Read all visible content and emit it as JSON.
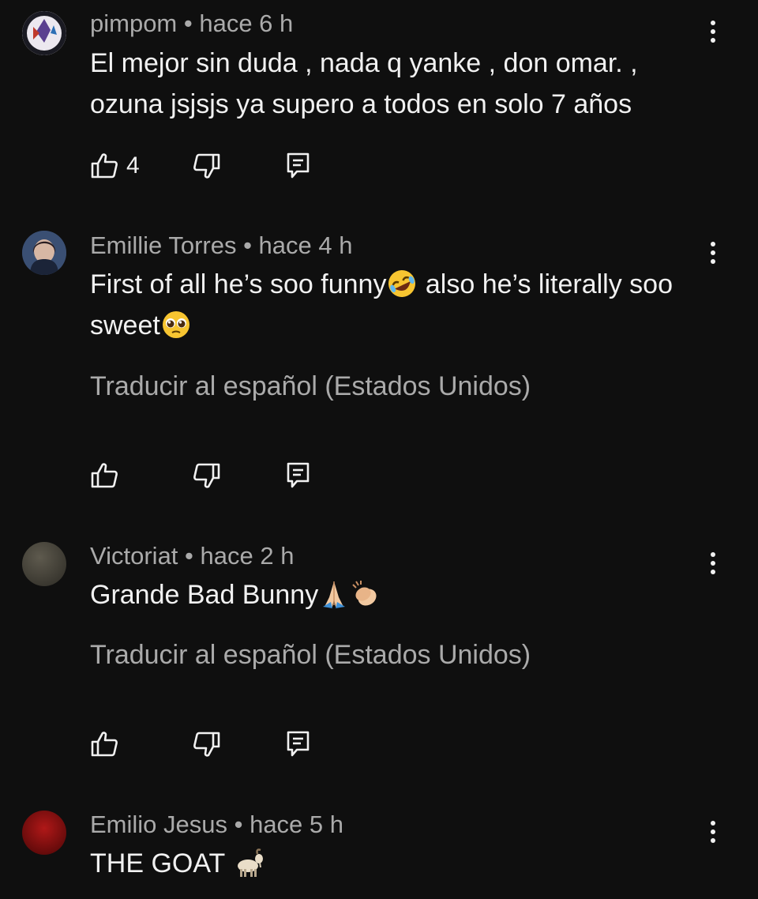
{
  "comments": [
    {
      "author": "pimpom",
      "time": "hace 6 h",
      "meta": "pimpom • hace 6 h",
      "text": "El mejor sin duda , nada q yanke , don omar. , ozuna jsjsjs ya supero a todos en solo 7 años",
      "likes": "4",
      "translate": ""
    },
    {
      "author": "Emillie Torres",
      "time": "hace 4 h",
      "meta": "Emillie Torres • hace 4 h",
      "text_part1": "First of all he’s soo funny",
      "text_part2": " also he’s literally soo sweet",
      "emoji1": "rolling-laughing-emoji",
      "emoji2": "pleading-face-emoji",
      "likes": "",
      "translate": "Traducir al español (Estados Unidos)"
    },
    {
      "author": "Victoriat",
      "time": "hace 2 h",
      "meta": "Victoriat • hace 2 h",
      "text": "Grande Bad Bunny",
      "emoji1": "folded-hands-emoji",
      "emoji2": "clapping-hands-emoji",
      "likes": "",
      "translate": "Traducir al español (Estados Unidos)"
    },
    {
      "author": "Emilio Jesus",
      "time": "hace 5 h",
      "meta": "Emilio Jesus • hace 5 h",
      "text": "THE GOAT ",
      "emoji1": "goat-emoji",
      "likes": "",
      "translate": ""
    }
  ],
  "icons": {
    "like": "thumbs-up-icon",
    "dislike": "thumbs-down-icon",
    "reply": "reply-icon",
    "more": "more-vertical-icon"
  },
  "colors": {
    "background": "#0f0f0f",
    "text": "#f1f1f1",
    "secondary": "#aaaaaa"
  }
}
